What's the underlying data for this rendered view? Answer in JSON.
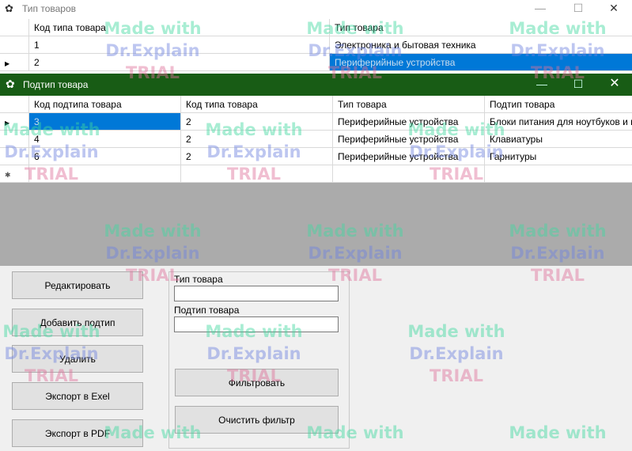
{
  "win1": {
    "title": "Тип товаров",
    "columns": [
      "Код типа товара",
      "Тип товара"
    ],
    "rows": [
      {
        "id": "1",
        "name": "Электроника и бытовая техника"
      },
      {
        "id": "2",
        "name": "Периферийные устройства"
      }
    ]
  },
  "win2": {
    "title": "Подтип товара",
    "columns": [
      "Код подтипа товара",
      "Код типа товара",
      "Тип товара",
      "Подтип товара"
    ],
    "rows": [
      {
        "id": "3",
        "type_id": "2",
        "type": "Периферийные устройства",
        "subtype": "Блоки питания для ноутбуков и по"
      },
      {
        "id": "4",
        "type_id": "2",
        "type": "Периферийные устройства",
        "subtype": "Клавиатуры"
      },
      {
        "id": "6",
        "type_id": "2",
        "type": "Периферийные устройства",
        "subtype": "Гарнитуры"
      }
    ],
    "buttons": {
      "edit": "Редактировать",
      "add": "Добавить подтип",
      "delete": "Удалить",
      "excel": "Экспорт в Exel",
      "pdf": "Экспорт в PDF"
    },
    "filter": {
      "type_label": "Тип товара",
      "type_value": "",
      "subtype_label": "Подтип товара",
      "subtype_value": "",
      "apply": "Фильтровать",
      "clear": "Очистить фильтр"
    }
  },
  "watermark": {
    "line1": "Made with",
    "line2": "Dr.Explain",
    "line3": "TRIAL"
  },
  "colors": {
    "title_bar": "#185c15",
    "selection": "#0078d7",
    "empty_grid": "#ababab"
  }
}
